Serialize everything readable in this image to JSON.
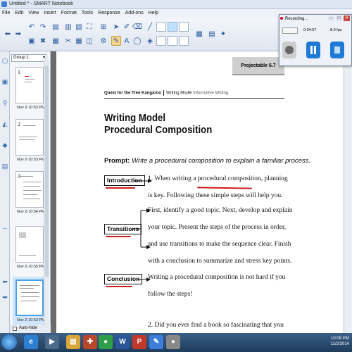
{
  "window": {
    "title": "Untitled * - SMART Notebook"
  },
  "menu": [
    "File",
    "Edit",
    "View",
    "Insert",
    "Format",
    "Tools",
    "Response",
    "Add-ons",
    "Help"
  ],
  "sorter": {
    "group": "Group 1",
    "thumbs": [
      {
        "num": "1",
        "caption": "Nov 2-10:53 PM"
      },
      {
        "num": "2",
        "caption": "Nov 2-10:53 PM"
      },
      {
        "num": "3",
        "caption": "Nov 2-10:54 PM"
      },
      {
        "num": "",
        "caption": "Nov 2-10:55 PM"
      },
      {
        "num": "",
        "caption": "Nov 2-10:53 PM"
      }
    ],
    "autohide": "Auto-hide"
  },
  "recording": {
    "title": "Recording...",
    "time": "0:04:57",
    "fps": "8.0 fps"
  },
  "page": {
    "projectable": "Projectable 6.7",
    "header_bold": "Quest for the Tree Kangaroo",
    "header_mid": "Writing Model",
    "header_light": "Informative Writing",
    "title_line1": "Writing Model",
    "title_line2": "Procedural Composition",
    "prompt_bold": "Prompt:",
    "prompt_text": "Write a procedural composition to explain a familiar process.",
    "labels": {
      "intro": "Introduction",
      "transitions": "Transitions",
      "conclusion": "Conclusion"
    },
    "lines": [
      "1.   When writing a procedural composition, planning",
      "is key. Following these simple steps will help you.",
      "First, identify a good topic. Next, develop and explain",
      "your topic. Present the steps of the process in order,",
      "and use transitions to make the sequence clear. Finish",
      "with a conclusion to summarize and stress key points.",
      "Writing a procedural composition is not hard if you",
      "follow the steps!",
      "2.   Did you ever find a book so fascinating that you"
    ]
  },
  "taskbar": {
    "time": "10:08 PM",
    "date": "11/2/2014"
  },
  "colors": {
    "accent": "#1f7ad6",
    "ink_red": "#cc1c1c",
    "taskbar": "#2b4a70"
  }
}
